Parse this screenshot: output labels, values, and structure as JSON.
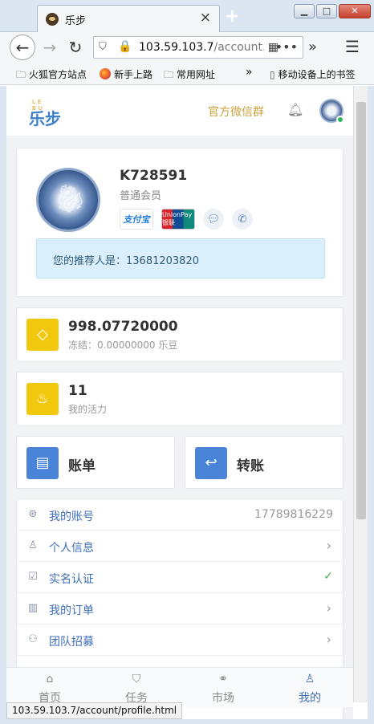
{
  "browser": {
    "tab_title": "乐步",
    "tab_close": "×",
    "new_tab": "+",
    "url_host": "103.59.103.7",
    "url_path": "/account.h",
    "window_buttons": [
      "▁",
      "□",
      "✕"
    ],
    "bookmarks": [
      "火狐官方站点",
      "新手上路",
      "常用网址",
      "移动设备上的书签"
    ],
    "status_url": "103.59.103.7/account/profile.html"
  },
  "header": {
    "logo_small": "LE BU",
    "logo": "乐步",
    "wechat_group": "官方微信群"
  },
  "profile": {
    "username": "K728591",
    "level": "普通会员",
    "pay_alipay": "支付宝",
    "pay_unionpay": "UnionPay 银联",
    "referrer_text": "您的推荐人是：13681203820"
  },
  "balance": {
    "amount": "998.07720000",
    "frozen": "冻结：0.00000000 乐豆"
  },
  "vitality": {
    "amount": "11",
    "label": "我的活力"
  },
  "actions": {
    "bill": "账单",
    "transfer": "转账"
  },
  "menu": [
    {
      "label": "我的账号",
      "value": "17789816229"
    },
    {
      "label": "个人信息"
    },
    {
      "label": "实名认证"
    },
    {
      "label": "我的订单"
    },
    {
      "label": "团队招募"
    }
  ],
  "tabbar": [
    {
      "label": "首页"
    },
    {
      "label": "任务"
    },
    {
      "label": "市场"
    },
    {
      "label": "我的"
    }
  ],
  "colors": {
    "accent": "#3f6fb6",
    "gold": "#f2c80f",
    "wechat_gold": "#c8a23d",
    "referrer_bg": "#dbeefb",
    "check_green": "#4cae4c"
  }
}
